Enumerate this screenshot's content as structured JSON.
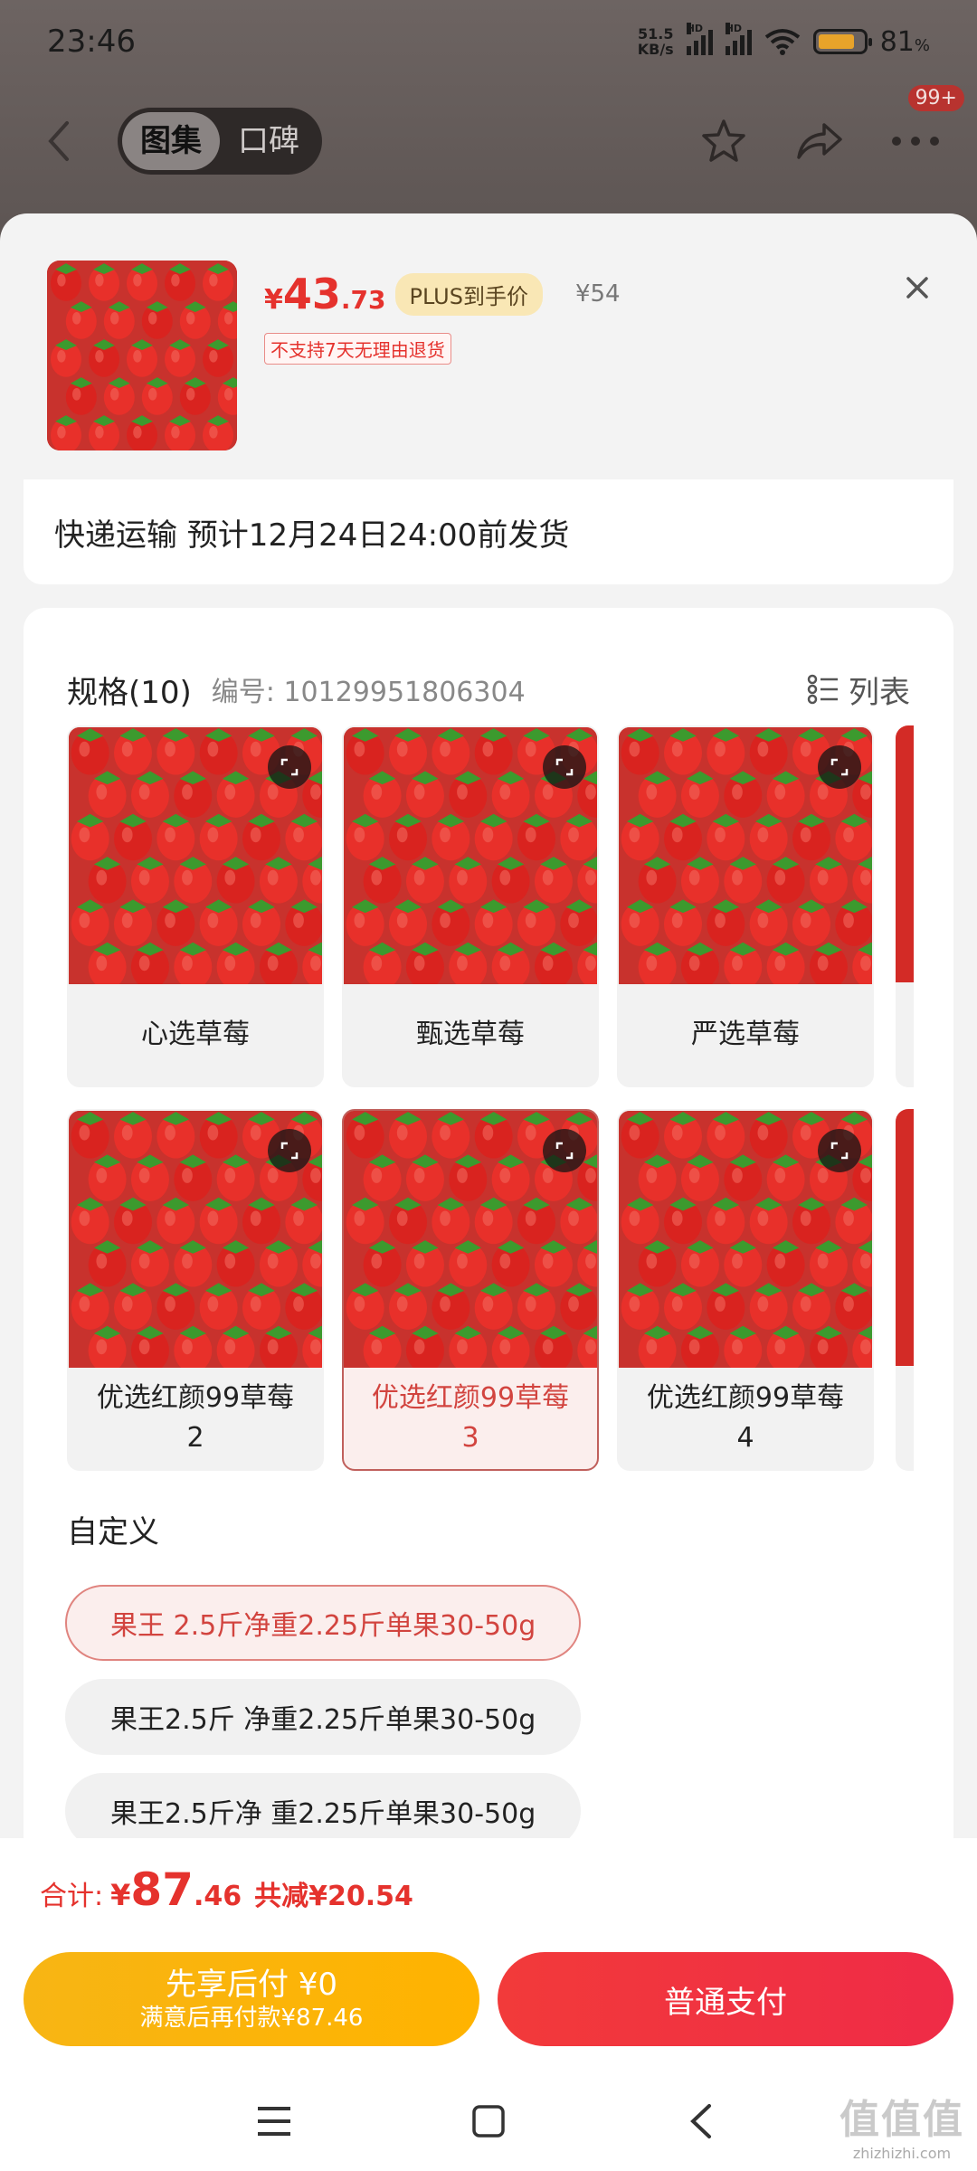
{
  "status_bar": {
    "time": "23:46",
    "net_speed_value": "51.5",
    "net_speed_unit": "KB/s",
    "hd_label_1": "HD",
    "hd_label_2": "HD",
    "battery_percent": "81",
    "battery_suffix": "%",
    "battery_level": 0.81,
    "battery_color": "#e8a32a"
  },
  "top_nav": {
    "tabs": [
      {
        "label": "图集",
        "active": true
      },
      {
        "label": "口碑",
        "active": false
      }
    ],
    "icons": [
      "back-icon",
      "star-icon",
      "share-icon",
      "more-icon"
    ],
    "more_badge": "99+"
  },
  "product": {
    "price_currency": "¥",
    "price_integer": "43",
    "price_decimal": ".73",
    "plus_tag": "PLUS到手价",
    "original_price": "¥54",
    "return_notice": "不支持7天无理由退货",
    "accent_color": "#e5322d"
  },
  "shipping": {
    "text": "快递运输 预计12月24日24:00前发货"
  },
  "spec": {
    "title": "规格(10)",
    "code": "编号: 10129951806304",
    "list_toggle_label": "列表",
    "options": [
      {
        "label": "心选草莓",
        "selected": false
      },
      {
        "label": "甄选草莓",
        "selected": false
      },
      {
        "label": "严选草莓",
        "selected": false
      },
      {
        "label": "优选红颜99草莓\n2",
        "selected": false
      },
      {
        "label": "优选红颜99草莓\n3",
        "selected": true
      },
      {
        "label": "优选红颜99草莓\n4",
        "selected": false
      }
    ]
  },
  "custom": {
    "title": "自定义",
    "options": [
      {
        "label": "果王 2.5斤净重2.25斤单果30-50g",
        "selected": true
      },
      {
        "label": "果王2.5斤 净重2.25斤单果30-50g",
        "selected": false
      },
      {
        "label": "果王2.5斤净 重2.25斤单果30-50g",
        "selected": false
      }
    ]
  },
  "footer": {
    "total_label": "合计:",
    "total_currency": "¥",
    "total_integer": "87",
    "total_decimal": ".46",
    "total_save": "共减¥20.54",
    "pay_later_line1": "先享后付 ¥0",
    "pay_later_line2": "满意后再付款¥87.46",
    "pay_normal": "普通支付"
  },
  "system_nav": {
    "icons": [
      "menu-icon",
      "home-icon",
      "back-icon"
    ]
  },
  "watermark": {
    "big": "值值值",
    "small": "zhizhizhi.com"
  }
}
